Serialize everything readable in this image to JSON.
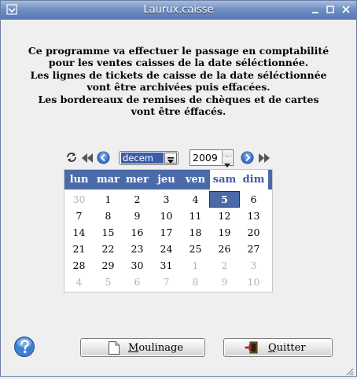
{
  "window": {
    "title": "Laurux.caisse",
    "minimize_label": "_",
    "maximize_label": "□",
    "close_label": "×"
  },
  "message_lines": [
    "Ce programme va effectuer le passage en comptabilité",
    "pour les ventes caisses de la date séléctionnée.",
    "Les lignes de tickets de caisse de la date séléctionnée",
    "vont être archivées puis effacées.",
    "Les bordereaux de remises de chèques et de cartes",
    "vont être éffacés."
  ],
  "calendar": {
    "month": "decem",
    "year": "2009",
    "weekday_headers": [
      "lun",
      "mar",
      "mer",
      "jeu",
      "ven",
      "sam",
      "dim"
    ],
    "selected_day": "5",
    "weeks": [
      [
        {
          "d": "30",
          "o": true
        },
        {
          "d": "1"
        },
        {
          "d": "2"
        },
        {
          "d": "3"
        },
        {
          "d": "4"
        },
        {
          "d": "5",
          "s": true
        },
        {
          "d": "6"
        }
      ],
      [
        {
          "d": "7"
        },
        {
          "d": "8"
        },
        {
          "d": "9"
        },
        {
          "d": "10"
        },
        {
          "d": "11"
        },
        {
          "d": "12"
        },
        {
          "d": "13"
        }
      ],
      [
        {
          "d": "14"
        },
        {
          "d": "15"
        },
        {
          "d": "16"
        },
        {
          "d": "17"
        },
        {
          "d": "18"
        },
        {
          "d": "19"
        },
        {
          "d": "20"
        }
      ],
      [
        {
          "d": "21"
        },
        {
          "d": "22"
        },
        {
          "d": "23"
        },
        {
          "d": "24"
        },
        {
          "d": "25"
        },
        {
          "d": "26"
        },
        {
          "d": "27"
        }
      ],
      [
        {
          "d": "28"
        },
        {
          "d": "29"
        },
        {
          "d": "30"
        },
        {
          "d": "31"
        },
        {
          "d": "1",
          "o": true
        },
        {
          "d": "2",
          "o": true
        },
        {
          "d": "3",
          "o": true
        }
      ],
      [
        {
          "d": "4",
          "o": true
        },
        {
          "d": "5",
          "o": true
        },
        {
          "d": "6",
          "o": true
        },
        {
          "d": "7",
          "o": true
        },
        {
          "d": "8",
          "o": true
        },
        {
          "d": "9",
          "o": true
        },
        {
          "d": "10",
          "o": true
        }
      ]
    ]
  },
  "buttons": {
    "moulinage": "Moulinage",
    "quitter": "Quitter"
  },
  "colors": {
    "header_blue": "#4a6aa8",
    "title_blue": "#5577b5",
    "weekend_text": "#3d5da6",
    "other_month": "#b3b3b3"
  },
  "icons": [
    "refresh-icon",
    "previous-year-icon",
    "previous-month-icon",
    "next-month-icon",
    "next-year-icon",
    "help-icon",
    "document-icon",
    "exit-door-icon",
    "resize-grip-icon"
  ]
}
